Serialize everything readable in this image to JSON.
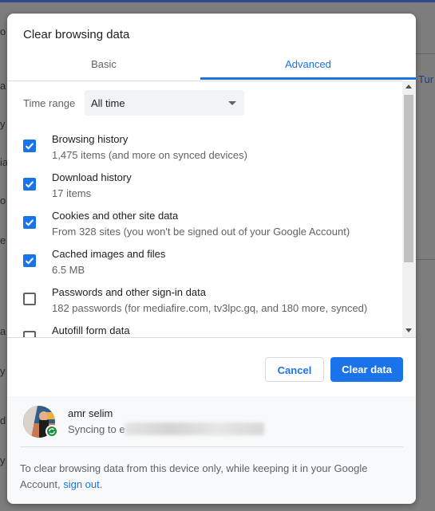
{
  "background": {
    "fragments": [
      "o",
      "a",
      "y",
      "ia",
      "o",
      "e",
      "a",
      "y",
      "d",
      "y"
    ],
    "right_link": "Tur"
  },
  "dialog": {
    "title": "Clear browsing data",
    "tabs": [
      {
        "label": "Basic",
        "active": false
      },
      {
        "label": "Advanced",
        "active": true
      }
    ],
    "time_range": {
      "label": "Time range",
      "value": "All time"
    },
    "items": [
      {
        "label": "Browsing history",
        "sub": "1,475 items (and more on synced devices)",
        "checked": true
      },
      {
        "label": "Download history",
        "sub": "17 items",
        "checked": true
      },
      {
        "label": "Cookies and other site data",
        "sub": "From 328 sites (you won't be signed out of your Google Account)",
        "checked": true
      },
      {
        "label": "Cached images and files",
        "sub": "6.5 MB",
        "checked": true
      },
      {
        "label": "Passwords and other sign-in data",
        "sub": "182 passwords (for mediafire.com, tv3lpc.gq, and 180 more, synced)",
        "checked": false
      },
      {
        "label": "Autofill form data",
        "sub": "",
        "checked": false
      }
    ],
    "buttons": {
      "cancel": "Cancel",
      "clear": "Clear data"
    },
    "account": {
      "name": "amr selim",
      "sync_prefix": "Syncing to e"
    },
    "footer": {
      "text": "To clear browsing data from this device only, while keeping it in your Google Account, ",
      "link": "sign out",
      "end": "."
    }
  },
  "colors": {
    "accent": "#1a73e8",
    "checkbox_off": "#5f6368",
    "sync_badge": "#1e8e3e"
  },
  "icons": {
    "dropdown": "caret-down-icon",
    "checkbox": "check-icon",
    "sync": "sync-icon"
  }
}
